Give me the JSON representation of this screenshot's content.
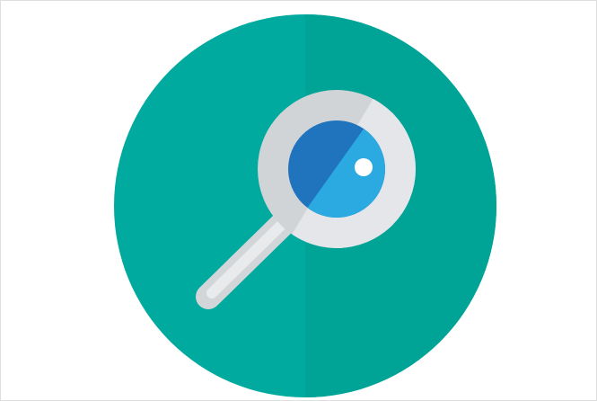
{
  "image": {
    "icon": "magnifying-glass-icon",
    "colors": {
      "background": "#ffffff",
      "circle_left": "#00aa9f",
      "circle_right": "#00a497",
      "ring_shadow": "#d1d4d7",
      "ring_highlight": "#e4e6e9",
      "lens_dark": "#2074be",
      "lens_light": "#2ba9e1",
      "lens_glint": "#ffffff",
      "handle_shadow": "#d3d6d9",
      "handle_highlight": "#e8eaec"
    }
  }
}
